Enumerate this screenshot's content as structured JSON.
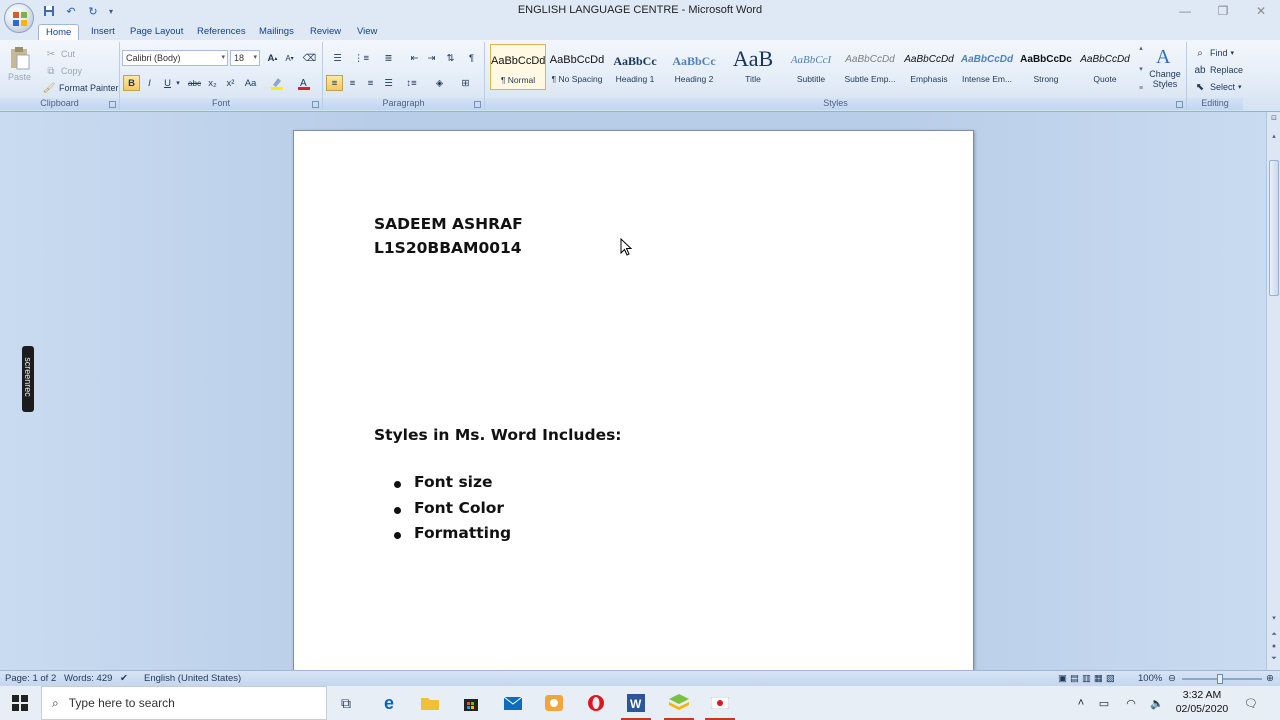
{
  "window": {
    "title": "ENGLISH LANGUAGE CENTRE - Microsoft Word",
    "controls": [
      "minimize",
      "restore",
      "close"
    ]
  },
  "quick_access": [
    "save-icon",
    "undo-icon",
    "redo-icon",
    "customize-icon"
  ],
  "tabs": [
    {
      "label": "Home",
      "active": true
    },
    {
      "label": "Insert"
    },
    {
      "label": "Page Layout"
    },
    {
      "label": "References"
    },
    {
      "label": "Mailings"
    },
    {
      "label": "Review"
    },
    {
      "label": "View"
    }
  ],
  "ribbon": {
    "clipboard": {
      "label": "Clipboard",
      "paste": "Paste",
      "cut": "Cut",
      "copy": "Copy",
      "format_painter": "Format Painter"
    },
    "font": {
      "label": "Font",
      "font_name": "Calibri (Body)",
      "font_size": "18",
      "grow": "A",
      "shrink": "A",
      "bold": "B",
      "italic": "I",
      "underline": "U",
      "strike": "abc",
      "subscript": "x₂",
      "superscript": "x²",
      "change_case": "Aa"
    },
    "paragraph": {
      "label": "Paragraph"
    },
    "styles": {
      "label": "Styles",
      "items": [
        {
          "preview": "AaBbCcDd",
          "name": "¶ Normal",
          "selected": true
        },
        {
          "preview": "AaBbCcDd",
          "name": "¶ No Spacing"
        },
        {
          "preview": "AaBbCc",
          "name": "Heading 1"
        },
        {
          "preview": "AaBbCc",
          "name": "Heading 2"
        },
        {
          "preview": "AaB",
          "name": "Title"
        },
        {
          "preview": "AaBbCcI",
          "name": "Subtitle"
        },
        {
          "preview": "AaBbCcDd",
          "name": "Subtle Emp..."
        },
        {
          "preview": "AaBbCcDd",
          "name": "Emphasis"
        },
        {
          "preview": "AaBbCcDd",
          "name": "Intense Em..."
        },
        {
          "preview": "AaBbCcDc",
          "name": "Strong"
        },
        {
          "preview": "AaBbCcDd",
          "name": "Quote"
        }
      ],
      "change_styles": "Change Styles"
    },
    "editing": {
      "label": "Editing",
      "find": "Find",
      "replace": "Replace",
      "select": "Select"
    }
  },
  "document": {
    "name_line": "SADEEM ASHRAF",
    "id_line": "L1S20BBAM0014",
    "heading": "Styles in Ms. Word Includes:",
    "bullets": [
      "Font size",
      "Font Color",
      "Formatting"
    ]
  },
  "overlay": {
    "screenrec": "screenrec"
  },
  "status": {
    "page": "Page: 1 of 2",
    "words": "Words: 429",
    "language": "English (United States)",
    "zoom": "100%"
  },
  "taskbar": {
    "search_placeholder": "Type here to search",
    "time": "3:32 AM",
    "date": "02/05/2020"
  }
}
